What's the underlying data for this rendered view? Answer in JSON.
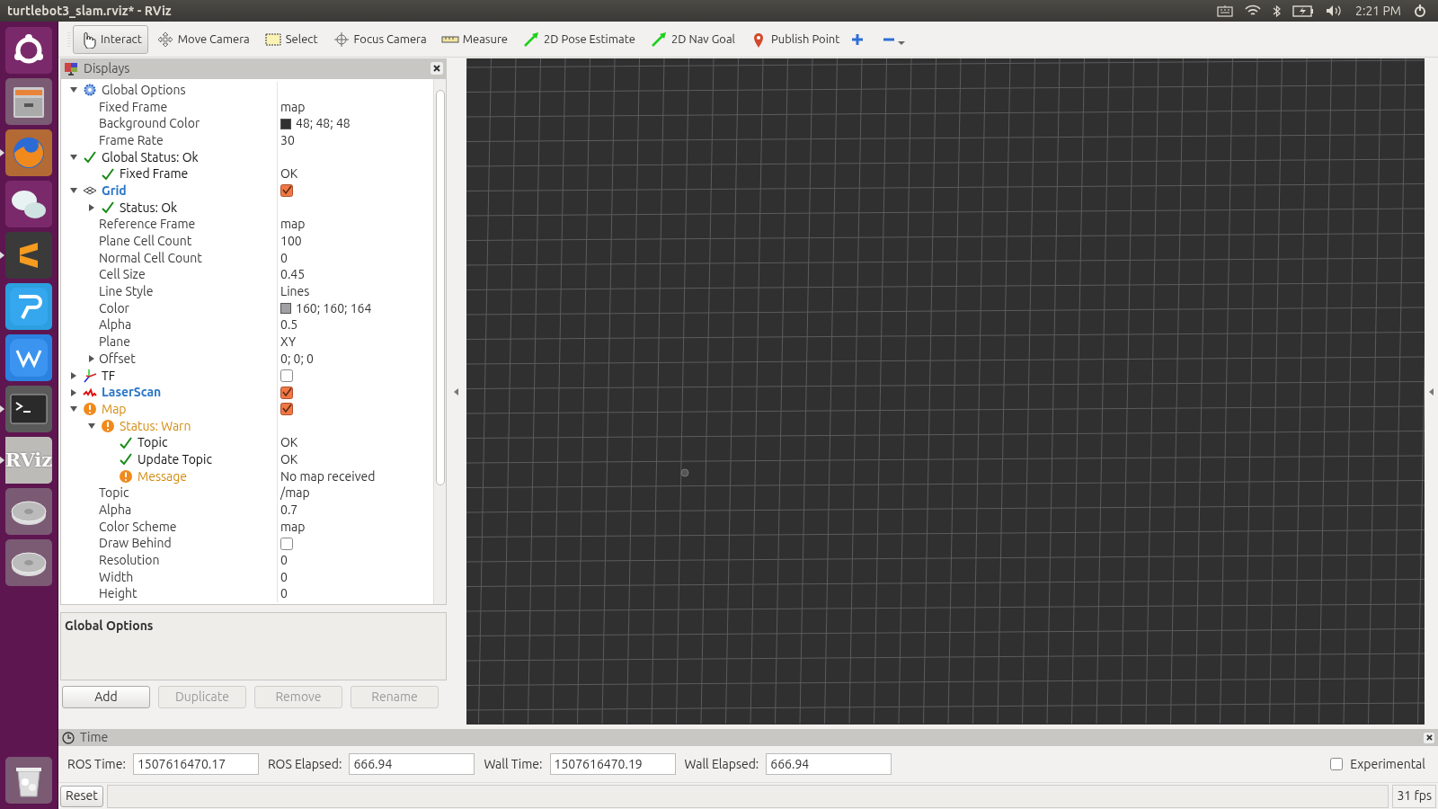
{
  "top_bar": {
    "title": "turtlebot3_slam.rviz* - RViz",
    "clock": "2:21 PM"
  },
  "launcher": [
    {
      "kind": "ubuntu",
      "running": false
    },
    {
      "kind": "files",
      "running": false
    },
    {
      "kind": "browser",
      "running": true
    },
    {
      "kind": "chat",
      "running": false
    },
    {
      "kind": "editor",
      "running": true
    },
    {
      "kind": "messenger",
      "running": false
    },
    {
      "kind": "office",
      "running": false
    },
    {
      "kind": "terminal",
      "running": true
    },
    {
      "kind": "rviz",
      "label": "RViz",
      "running": true
    },
    {
      "kind": "disk",
      "running": false
    },
    {
      "kind": "disk",
      "running": false
    },
    {
      "kind": "trash",
      "running": false
    }
  ],
  "toolbar": [
    {
      "label": "Interact",
      "kind": "hand",
      "selected": true
    },
    {
      "label": "Move Camera",
      "kind": "move",
      "selected": false
    },
    {
      "label": "Select",
      "kind": "select",
      "selected": false
    },
    {
      "label": "Focus Camera",
      "kind": "focus",
      "selected": false
    },
    {
      "label": "Measure",
      "kind": "ruler",
      "selected": false
    },
    {
      "label": "2D Pose Estimate",
      "kind": "arrow",
      "selected": false
    },
    {
      "label": "2D Nav Goal",
      "kind": "arrow",
      "selected": false
    },
    {
      "label": "Publish Point",
      "kind": "pin",
      "selected": false
    }
  ],
  "displays": {
    "title": "Displays",
    "tree": [
      {
        "label": "Global Options",
        "kind": "global",
        "expanded": true,
        "children": [
          {
            "label": "Fixed Frame",
            "kind": "property",
            "value": "map"
          },
          {
            "label": "Background Color",
            "kind": "property",
            "value": "48; 48; 48",
            "color": "#303030"
          },
          {
            "label": "Frame Rate",
            "kind": "property",
            "value": "30"
          }
        ]
      },
      {
        "label": "Global Status: Ok",
        "kind": "ok",
        "expanded": true,
        "children": [
          {
            "label": "Fixed Frame",
            "kind": "ok",
            "value": "OK"
          }
        ]
      },
      {
        "label": "Grid",
        "kind": "grid",
        "expanded": true,
        "checked": true,
        "children": [
          {
            "label": "Status: Ok",
            "kind": "ok",
            "expanded": false
          },
          {
            "label": "Reference Frame",
            "kind": "property",
            "value": "map"
          },
          {
            "label": "Plane Cell Count",
            "kind": "property",
            "value": "100"
          },
          {
            "label": "Normal Cell Count",
            "kind": "property",
            "value": "0"
          },
          {
            "label": "Cell Size",
            "kind": "property",
            "value": "0.45"
          },
          {
            "label": "Line Style",
            "kind": "property",
            "value": "Lines"
          },
          {
            "label": "Color",
            "kind": "property",
            "value": "160; 160; 164",
            "color": "#a0a0a4"
          },
          {
            "label": "Alpha",
            "kind": "property",
            "value": "0.5"
          },
          {
            "label": "Plane",
            "kind": "property",
            "value": "XY"
          },
          {
            "label": "Offset",
            "kind": "property",
            "value": "0; 0; 0",
            "expanded": false
          }
        ]
      },
      {
        "label": "TF",
        "kind": "tf",
        "expanded": false,
        "checked": false
      },
      {
        "label": "LaserScan",
        "kind": "laser",
        "expanded": false,
        "checked": true
      },
      {
        "label": "Map",
        "kind": "warn",
        "expanded": true,
        "checked": true,
        "children": [
          {
            "label": "Status: Warn",
            "kind": "warn",
            "expanded": true,
            "children": [
              {
                "label": "Topic",
                "kind": "ok",
                "value": "OK"
              },
              {
                "label": "Update Topic",
                "kind": "ok",
                "value": "OK"
              },
              {
                "label": "Message",
                "kind": "warn",
                "value": "No map received"
              }
            ]
          },
          {
            "label": "Topic",
            "kind": "property",
            "value": "/map"
          },
          {
            "label": "Alpha",
            "kind": "property",
            "value": "0.7"
          },
          {
            "label": "Color Scheme",
            "kind": "property",
            "value": "map"
          },
          {
            "label": "Draw Behind",
            "kind": "property",
            "checked": false
          },
          {
            "label": "Resolution",
            "kind": "property",
            "value": "0"
          },
          {
            "label": "Width",
            "kind": "property",
            "value": "0"
          },
          {
            "label": "Height",
            "kind": "property",
            "value": "0"
          }
        ]
      }
    ],
    "description": "Global Options",
    "buttons": [
      {
        "label": "Add",
        "disabled": false
      },
      {
        "label": "Duplicate",
        "disabled": true
      },
      {
        "label": "Remove",
        "disabled": true
      },
      {
        "label": "Rename",
        "disabled": true
      }
    ]
  },
  "time_panel": {
    "title": "Time",
    "fields": [
      {
        "label": "ROS Time:",
        "value": "1507616470.17"
      },
      {
        "label": "ROS Elapsed:",
        "value": "666.94"
      },
      {
        "label": "Wall Time:",
        "value": "1507616470.19"
      },
      {
        "label": "Wall Elapsed:",
        "value": "666.94"
      }
    ],
    "experimental": {
      "label": "Experimental",
      "checked": false
    }
  },
  "status_bar": {
    "reset": "Reset",
    "fps": "31 fps"
  }
}
